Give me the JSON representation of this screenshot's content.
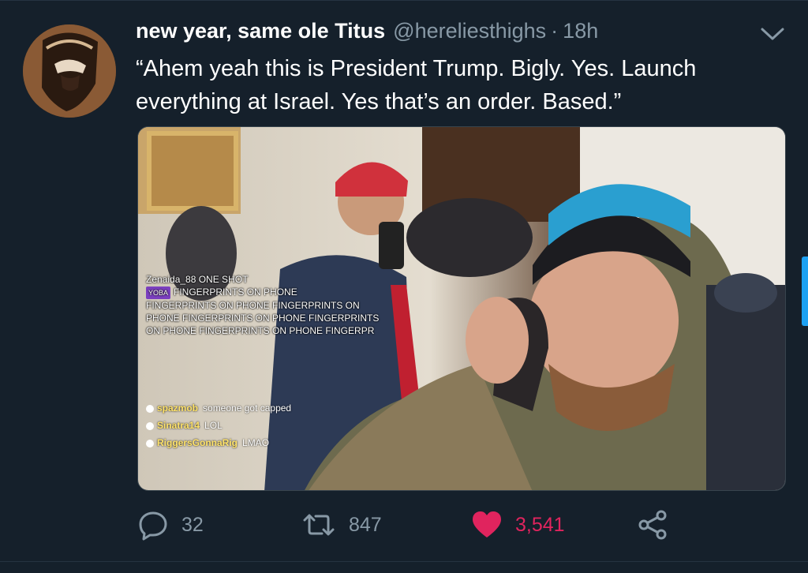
{
  "tweet": {
    "display_name": "new year, same ole Titus",
    "handle": "@hereliesthighs",
    "separator": "·",
    "time": "18h",
    "text": "“Ahem yeah this is President Trump. Bigly. Yes. Launch everything at Israel. Yes that’s an order. Based.”"
  },
  "media": {
    "overlay_lines": [
      "Zenaida_88 ONE SHOT",
      "FINGERPRINTS ON PHONE",
      "FINGERPRINTS ON PHONE FINGERPRINTS ON",
      "PHONE FINGERPRINTS ON PHONE FINGERPRINTS",
      "ON PHONE FINGERPRINTS ON PHONE FINGERPR"
    ],
    "overlay_tag": "YOBA",
    "chat": [
      {
        "user": "spazmob",
        "msg": "someone got capped"
      },
      {
        "user": "Sinatra14",
        "msg": "LOL"
      },
      {
        "user": "RiggersGonnaRig",
        "msg": "LMAO"
      }
    ]
  },
  "actions": {
    "reply_count": "32",
    "retweet_count": "847",
    "like_count": "3,541"
  },
  "colors": {
    "background": "#15202b",
    "secondary_text": "#8899a6",
    "like": "#e0245e",
    "accent": "#1da1f2"
  },
  "icons": {
    "reply": "reply-icon",
    "retweet": "retweet-icon",
    "like": "heart-icon",
    "share": "share-icon",
    "menu": "chevron-down-icon"
  }
}
